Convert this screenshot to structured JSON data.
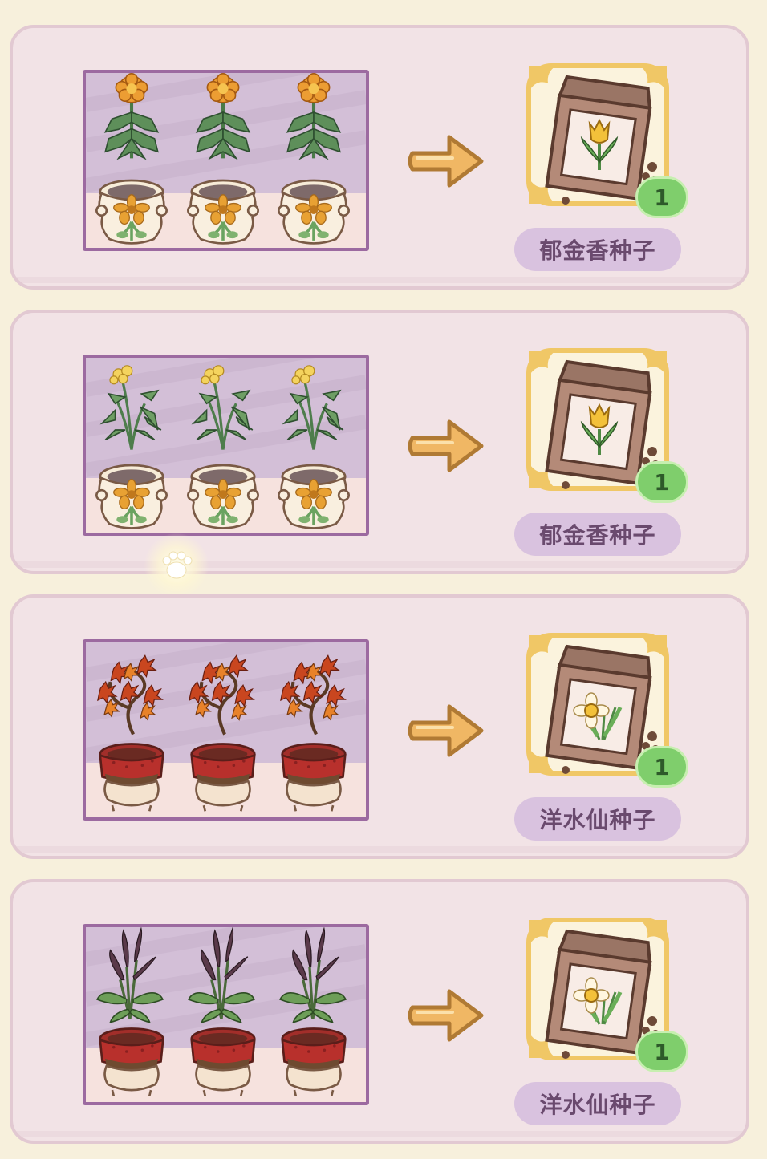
{
  "recipes": [
    {
      "plant_icon": "orange-marigold-potted-plant",
      "plant_count": 3,
      "reward": {
        "icon": "tulip-seed-packet-icon",
        "label": "郁金香种子",
        "count": "1"
      }
    },
    {
      "plant_icon": "yellow-flower-potted-plant",
      "plant_count": 3,
      "reward": {
        "icon": "tulip-seed-packet-icon",
        "label": "郁金香种子",
        "count": "1"
      }
    },
    {
      "plant_icon": "red-maple-bonsai-potted-plant",
      "plant_count": 3,
      "reward": {
        "icon": "daffodil-seed-packet-icon",
        "label": "洋水仙种子",
        "count": "1"
      }
    },
    {
      "plant_icon": "purple-leaf-potted-plant",
      "plant_count": 3,
      "reward": {
        "icon": "daffodil-seed-packet-icon",
        "label": "洋水仙种子",
        "count": "1"
      }
    }
  ],
  "colors": {
    "card_bg": "#f2e3e6",
    "card_border": "#e2c9d2",
    "label_bg": "#d9c2df",
    "label_text": "#6a4a6e",
    "badge_bg": "#7fce6c",
    "arrow": "#f0b764"
  }
}
